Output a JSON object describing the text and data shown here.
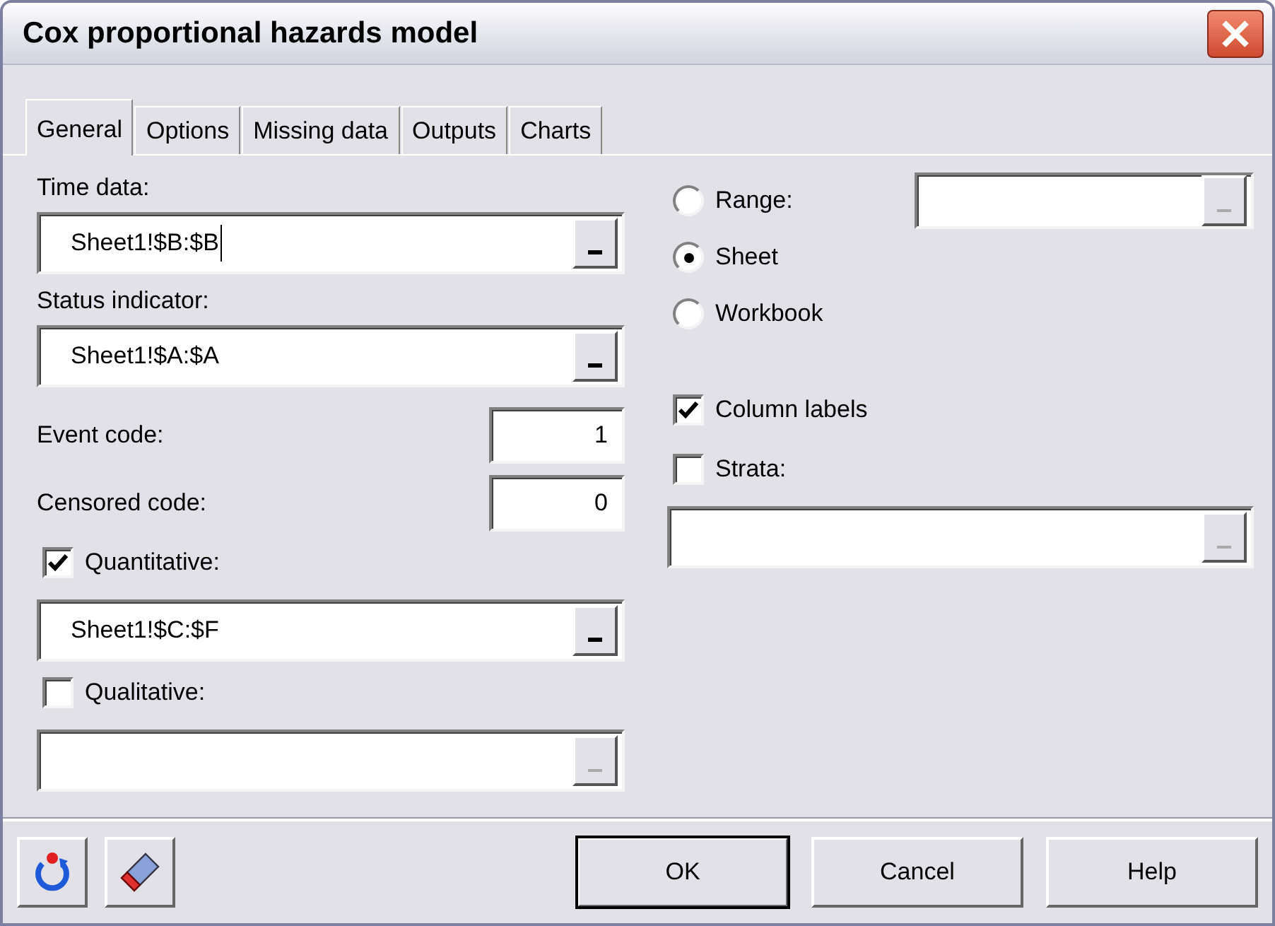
{
  "window": {
    "title": "Cox proportional hazards model"
  },
  "tabs": [
    {
      "label": "General",
      "selected": true
    },
    {
      "label": "Options",
      "selected": false
    },
    {
      "label": "Missing data",
      "selected": false
    },
    {
      "label": "Outputs",
      "selected": false
    },
    {
      "label": "Charts",
      "selected": false
    }
  ],
  "left": [
    {
      "kind": "label",
      "text": "Time data:"
    },
    {
      "kind": "range",
      "value": "Sheet1!$B:$B",
      "disabled": false,
      "focused": true
    },
    {
      "kind": "label",
      "text": "Status indicator:"
    },
    {
      "kind": "range",
      "value": "Sheet1!$A:$A",
      "disabled": false,
      "focused": false
    },
    {
      "kind": "code",
      "label": "Event code:",
      "value": "1"
    },
    {
      "kind": "code",
      "label": "Censored code:",
      "value": "0"
    },
    {
      "kind": "checkbox",
      "label": "Quantitative:",
      "checked": true
    },
    {
      "kind": "range",
      "value": "Sheet1!$C:$F",
      "disabled": false,
      "focused": false
    },
    {
      "kind": "checkbox",
      "label": "Qualitative:",
      "checked": false
    },
    {
      "kind": "range",
      "disabled": true
    }
  ],
  "scope": [
    {
      "label": "Range:",
      "selected": false
    },
    {
      "label": "Sheet",
      "selected": true
    },
    {
      "label": "Workbook",
      "selected": false
    }
  ],
  "scope_range": {
    "disabled": true
  },
  "right": [
    {
      "kind": "checkbox",
      "label": "Column labels",
      "checked": true
    },
    {
      "kind": "checkbox",
      "label": "Strata:",
      "checked": false
    },
    {
      "kind": "range",
      "disabled": true
    }
  ],
  "buttons": [
    {
      "label": "OK",
      "default": true
    },
    {
      "label": "Cancel",
      "default": false
    },
    {
      "label": "Help",
      "default": false
    }
  ]
}
